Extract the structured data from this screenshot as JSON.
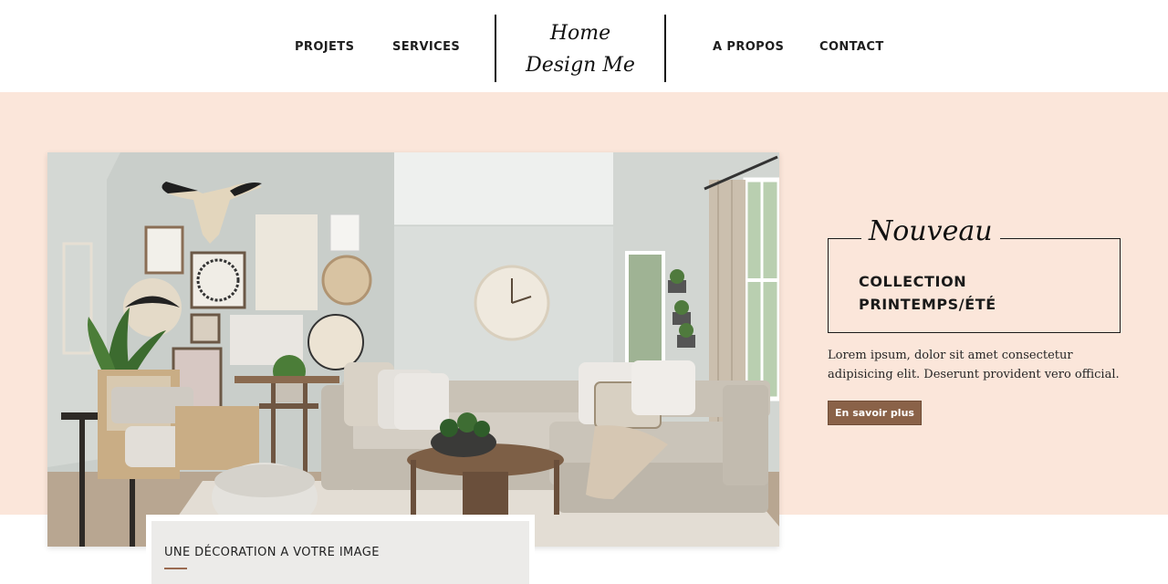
{
  "header": {
    "nav_left": [
      "PROJETS",
      "SERVICES"
    ],
    "nav_right": [
      "A PROPOS",
      "CONTACT"
    ],
    "logo": {
      "line1": "Home",
      "line2": "Design Me"
    }
  },
  "hero": {
    "badge": "Nouveau",
    "collection_line1": "COLLECTION",
    "collection_line2": "PRINTEMPS/ÉTÉ",
    "text": "Lorem ipsum, dolor sit amet consectetur adipisicing elit. Deserunt provident vero official.",
    "cta_label": "En savoir plus"
  },
  "caption": {
    "title": "UNE DÉCORATION A VOTRE IMAGE"
  },
  "colors": {
    "hero_background": "#fbe6da",
    "cta_background": "#8a6248",
    "caption_background": "#ecebe9",
    "accent_line": "#9a6a50"
  }
}
